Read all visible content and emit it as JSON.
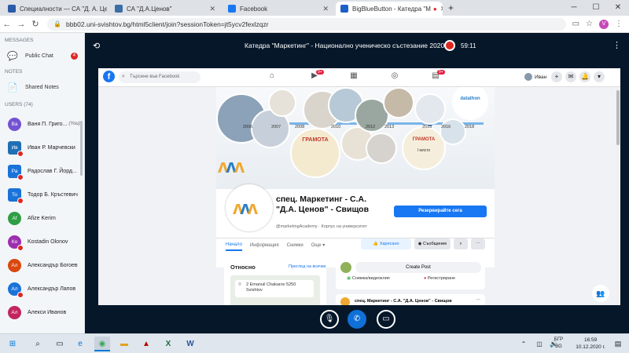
{
  "browser": {
    "tabs": [
      {
        "title": "Специалности — СА \"Д. А. Цен",
        "favicon_color": "#2b5aa8"
      },
      {
        "title": "СА \"Д.А.Ценов\"",
        "favicon_color": "#3a6ea5"
      },
      {
        "title": "Facebook",
        "favicon_color": "#1877f2"
      },
      {
        "title": "BigBlueButton - Катедра \"М",
        "favicon_color": "#1d5fc9"
      }
    ],
    "new_tab": "+",
    "url": "bbb02.uni-svishtov.bg/html5client/join?sessionToken=jt5ycv2fexlzqzr",
    "profile_initial": "V"
  },
  "sidebar": {
    "messages_header": "MESSAGES",
    "public_chat": "Public Chat",
    "public_chat_badge": "4",
    "notes_header": "NOTES",
    "shared_notes": "Shared Notes",
    "users_header": "USERS (74)",
    "users": [
      {
        "initials": "Ва",
        "name": "Ваня П. Григо...",
        "you": "(You)",
        "color": "#7353d1"
      },
      {
        "initials": "Ив",
        "name": "Иван Р. Марчевски",
        "color": "#1f6fb5"
      },
      {
        "initials": "Ра",
        "name": "Радослав Г. Йорд...",
        "color": "#1a73d9"
      },
      {
        "initials": "То",
        "name": "Тодор Б. Кръстевич",
        "color": "#1a73d9"
      },
      {
        "initials": "Af",
        "name": "Afize Kerim",
        "color": "#2f9e44"
      },
      {
        "initials": "Ко",
        "name": "Kostadin Olonov",
        "color": "#9c2fb0"
      },
      {
        "initials": "Ал",
        "name": "Александър Богоев",
        "color": "#d9480f"
      },
      {
        "initials": "Ал",
        "name": "Александър Лапов",
        "color": "#1a73d9"
      },
      {
        "initials": "Ал",
        "name": "Алекси Иванов",
        "color": "#c2255c"
      }
    ]
  },
  "bbb": {
    "title": "Катедра \"Маркетинг\" - Национално ученическо състезание 2020",
    "timer": "59:11"
  },
  "facebook": {
    "search_placeholder": "Търсене във Facebook",
    "nav_badges": [
      "9+",
      "9+"
    ],
    "user_name": "Иван",
    "page_name": "спец. Маркетинг - С.А. \"Д.А. Ценов\" - Свищов",
    "page_handle": "@marketingAcademy · Корпус на университет",
    "reserve_button": "Резервирайте сега",
    "tabs": [
      "Начало",
      "Информация",
      "Снимки",
      "Още ▾"
    ],
    "liked_button": "Харесано",
    "message_button": "Съобщение",
    "timeline_years": [
      "2006",
      "2007",
      "2008",
      "2010",
      "2012",
      "2013",
      "2015",
      "2016",
      "2018"
    ],
    "cover_text": {
      "gramota": "ГРАМОТА",
      "gramota2": "ГРАМОТА",
      "place": "I място",
      "datathon": "datathon"
    },
    "about_card": {
      "heading": "Относно",
      "link": "Преглед на всички",
      "address_line1": "2 Emanuil Chakarov 5250",
      "address_line2": "Svishtov"
    },
    "create_post": "Create Post",
    "photo_video": "Снимка/видеоклип",
    "register": "Регистриране",
    "post_author": "спец. Маркетинг - С.А. \"Д.А. Ценов\" - Свищов"
  },
  "taskbar": {
    "lang_line1": "БГР",
    "lang_line2": "BG",
    "time": "16:59",
    "date": "10.12.2020 г."
  }
}
